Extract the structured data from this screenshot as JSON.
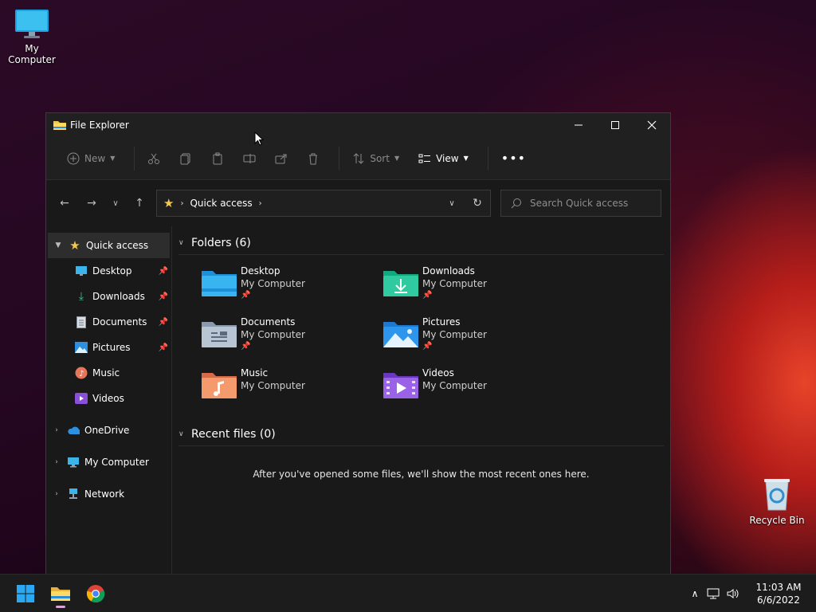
{
  "desktop": {
    "icons": [
      {
        "label": "My Computer"
      },
      {
        "label": "Recycle Bin"
      }
    ]
  },
  "window": {
    "title": "File Explorer",
    "toolbar": {
      "new_label": "New",
      "sort_label": "Sort",
      "view_label": "View"
    },
    "address": {
      "crumb": "Quick access"
    },
    "search": {
      "placeholder": "Search Quick access"
    },
    "navpane": {
      "quick_access": "Quick access",
      "pinned": [
        {
          "label": "Desktop",
          "pinned": true
        },
        {
          "label": "Downloads",
          "pinned": true
        },
        {
          "label": "Documents",
          "pinned": true
        },
        {
          "label": "Pictures",
          "pinned": true
        },
        {
          "label": "Music",
          "pinned": false
        },
        {
          "label": "Videos",
          "pinned": false
        }
      ],
      "onedrive": "OneDrive",
      "my_computer": "My Computer",
      "network": "Network"
    },
    "content": {
      "folders_header": "Folders (6)",
      "folders": [
        {
          "name": "Desktop",
          "location": "My Computer",
          "pinned": true
        },
        {
          "name": "Downloads",
          "location": "My Computer",
          "pinned": true
        },
        {
          "name": "Documents",
          "location": "My Computer",
          "pinned": true
        },
        {
          "name": "Pictures",
          "location": "My Computer",
          "pinned": true
        },
        {
          "name": "Music",
          "location": "My Computer",
          "pinned": false
        },
        {
          "name": "Videos",
          "location": "My Computer",
          "pinned": false
        }
      ],
      "recent_header": "Recent files (0)",
      "empty_message": "After you've opened some files, we'll show the most recent ones here."
    }
  },
  "taskbar": {
    "clock_time": "11:03 AM",
    "clock_date": "6/6/2022"
  },
  "colors": {
    "accent": "#0078d4",
    "folder_yellow": "#f5c84c",
    "window_bg": "#191919"
  }
}
